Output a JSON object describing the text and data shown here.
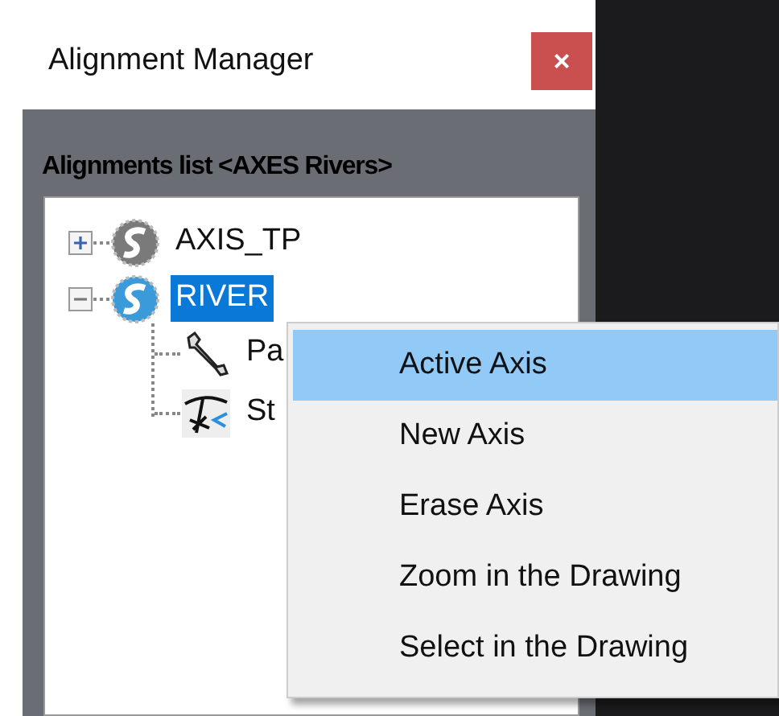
{
  "window": {
    "title": "Alignment Manager",
    "close": "×"
  },
  "list_label": "Alignments list <AXES Rivers>",
  "tree": [
    {
      "label": "AXIS_TP",
      "kind": "axis",
      "active": false,
      "expanded": false,
      "selected": false
    },
    {
      "label": "RIVER",
      "kind": "axis",
      "active": true,
      "expanded": true,
      "selected": true,
      "children": [
        {
          "label": "Pa",
          "kind": "parameters",
          "selected": false
        },
        {
          "label": "St",
          "kind": "stations",
          "selected": false
        }
      ]
    }
  ],
  "context_menu": [
    {
      "label": "Active Axis",
      "selected": true
    },
    {
      "label": "New Axis",
      "selected": false
    },
    {
      "label": "Erase Axis",
      "selected": false
    },
    {
      "label": "Zoom in the Drawing",
      "selected": false
    },
    {
      "label": "Select in the Drawing",
      "selected": false
    }
  ]
}
